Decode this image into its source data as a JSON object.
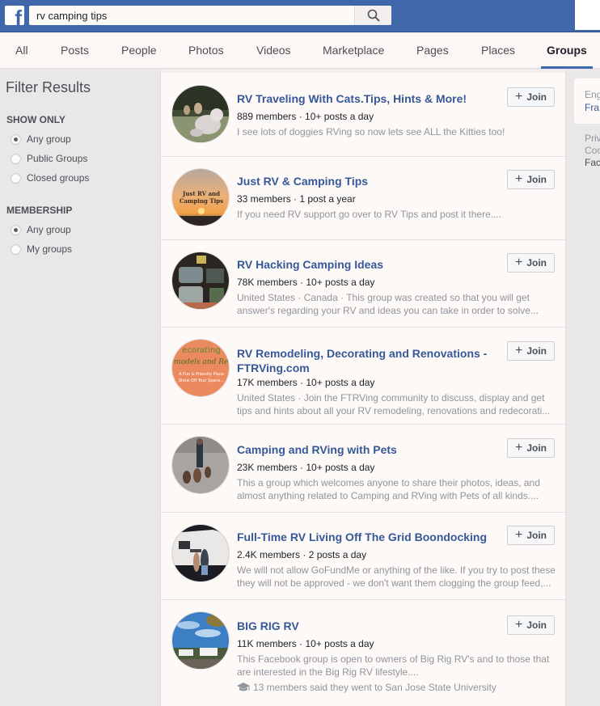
{
  "topbar": {
    "logo": "f",
    "search_value": "rv camping tips",
    "search_placeholder": "Search"
  },
  "tabs": [
    {
      "label": "All",
      "active": false
    },
    {
      "label": "Posts",
      "active": false
    },
    {
      "label": "People",
      "active": false
    },
    {
      "label": "Photos",
      "active": false
    },
    {
      "label": "Videos",
      "active": false
    },
    {
      "label": "Marketplace",
      "active": false
    },
    {
      "label": "Pages",
      "active": false
    },
    {
      "label": "Places",
      "active": false
    },
    {
      "label": "Groups",
      "active": true
    }
  ],
  "sidebar": {
    "title": "Filter Results",
    "show_only": {
      "heading": "SHOW ONLY",
      "options": [
        {
          "label": "Any group",
          "checked": true
        },
        {
          "label": "Public Groups",
          "checked": false
        },
        {
          "label": "Closed groups",
          "checked": false
        }
      ]
    },
    "membership": {
      "heading": "MEMBERSHIP",
      "options": [
        {
          "label": "Any group",
          "checked": true
        },
        {
          "label": "My groups",
          "checked": false
        }
      ]
    }
  },
  "results": [
    {
      "title": "RV Traveling With Cats.Tips, Hints & More!",
      "meta": "889 members · 10+ posts a day",
      "description": "I see lots of doggies RVing so now lets see ALL the Kitties too!",
      "join_label": "Join"
    },
    {
      "title": "Just RV & Camping Tips",
      "meta": "33 members · 1 post a year",
      "description": "If you need RV support go over to RV Tips and post it there....",
      "avatar_text": "Just RV and Camping Tips",
      "join_label": "Join"
    },
    {
      "title": "RV Hacking Camping Ideas",
      "meta": "78K members · 10+ posts a day",
      "description": "United States · Canada · This group was created so that you will get answer's regarding your RV and ideas you can take in order to solve...",
      "join_label": "Join"
    },
    {
      "title": "RV Remodeling, Decorating and Renovations - FTRVing.com",
      "meta": "17K members · 10+ posts a day",
      "description": "United States · Join the FTRVing community to discuss, display and get tips and hints about all your RV remodeling, renovations and redecorati...",
      "avatar_text_1": "Decorating",
      "avatar_text_2": "Remodels and Ren",
      "avatar_text_3": "A Fun & Friendly Place",
      "avatar_text_4": "Show Off Your Space...",
      "join_label": "Join"
    },
    {
      "title": "Camping and RVing with Pets",
      "meta": "23K members · 10+ posts a day",
      "description": "This a group which welcomes anyone to share their photos, ideas, and almost anything related to Camping and RVing with Pets of all kinds....",
      "join_label": "Join"
    },
    {
      "title": "Full-Time RV Living Off The Grid Boondocking",
      "meta": "2.4K members · 2 posts a day",
      "description": "We will not allow GoFundMe or anything of the like. If you try to post these they will not be approved - we don't want them clogging the group feed,...",
      "join_label": "Join"
    },
    {
      "title": "BIG RIG RV",
      "meta": "11K members · 10+ posts a day",
      "description": "This Facebook group is open to owners of Big Rig RV's and to those that are interested in the Big Rig RV lifestyle....",
      "extra": "13 members said they went to San Jose State University",
      "join_label": "Join"
    }
  ],
  "rightcol": {
    "lang_current": "Eng",
    "lang_link": "Fra",
    "footer_1": "Priv",
    "footer_2": "Coo",
    "footer_3": "Fac"
  }
}
